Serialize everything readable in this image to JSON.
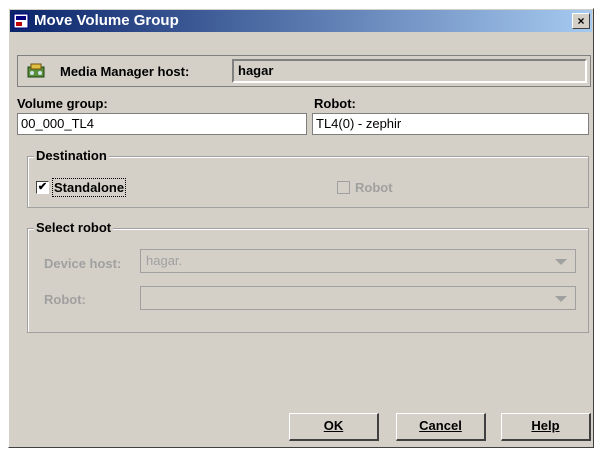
{
  "window": {
    "title": "Move Volume Group",
    "close_glyph": "×"
  },
  "host": {
    "label": "Media Manager host:",
    "value": "hagar"
  },
  "volume_group": {
    "label": "Volume group:",
    "value": "00_000_TL4"
  },
  "robot_field": {
    "label": "Robot:",
    "value": "TL4(0) - zephir"
  },
  "destination": {
    "title": "Destination",
    "standalone": {
      "label": "Standalone",
      "checked": true,
      "check_glyph": "✔"
    },
    "robot": {
      "label": "Robot",
      "checked": false
    }
  },
  "select_robot": {
    "title": "Select robot",
    "device_host_label": "Device host:",
    "device_host_value": "hagar.",
    "robot_label": "Robot:",
    "robot_value": ""
  },
  "buttons": {
    "ok": "OK",
    "cancel": "Cancel",
    "help": "Help"
  },
  "icons": {
    "title": "window-app-icon",
    "host": "media-manager-host-icon"
  }
}
